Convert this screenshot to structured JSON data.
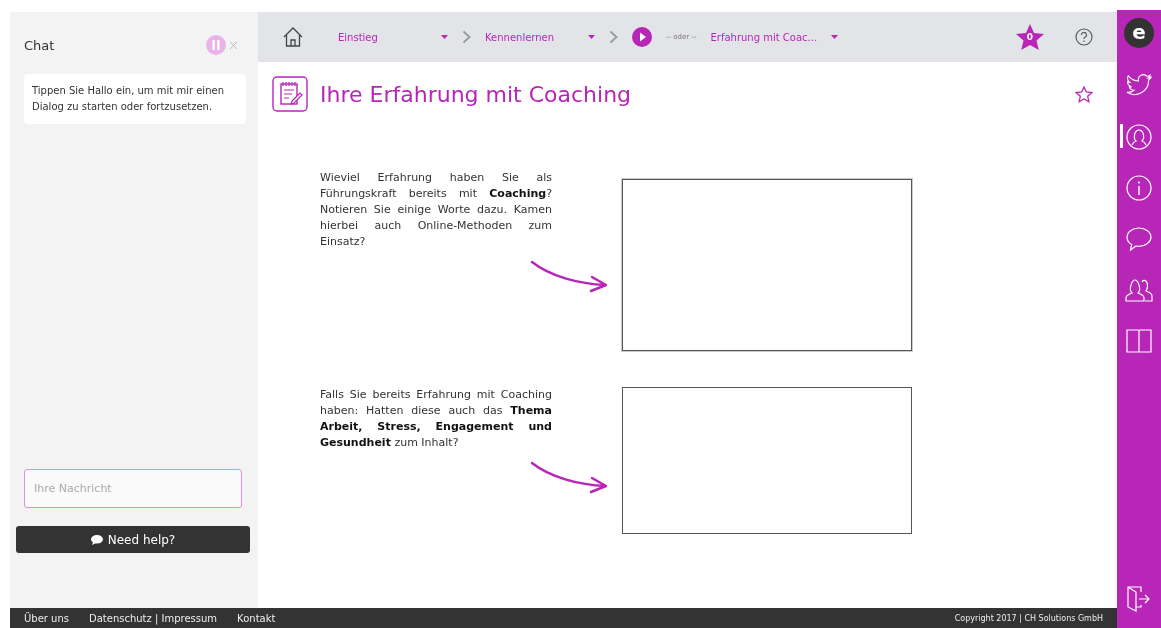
{
  "chat": {
    "title": "Chat",
    "paused": true,
    "hint": "Tippen Sie Hallo ein, um mit mir einen Dialog zu starten oder fortzusetzen.",
    "input": {
      "placeholder": "Ihre Nachricht"
    },
    "help_button": "Need help?"
  },
  "breadcrumbs": [
    {
      "kind": "link",
      "label": "Einstieg"
    },
    {
      "kind": "link",
      "label": "Kennenlernen"
    },
    {
      "kind": "current",
      "label": "Erfahrung mit Coac...",
      "prefix": "-- oder --"
    }
  ],
  "favorites_count": "0",
  "page": {
    "title": "Ihre Erfahrung mit Coaching",
    "bookmarked": false
  },
  "questions": [
    {
      "text": "Wieviel Erfahrung haben Sie als Führungskraft bereits mit **Coaching**? Notieren Sie einige Worte dazu. Kamen hierbei auch Online-Methoden zum Einsatz?",
      "focused": true
    },
    {
      "text": "Falls Sie bereits Erfahrung mit Coaching haben: Hatten diese auch das **Thema Arbeit, Stress, Engagement und Gesundheit** zum Inhalt?",
      "focused": false
    }
  ],
  "sidebar": {
    "logo": "e",
    "items": [
      {
        "kind": "bird",
        "selected": false
      },
      {
        "kind": "person",
        "selected": true
      },
      {
        "kind": "info",
        "selected": false
      },
      {
        "kind": "speech",
        "selected": false
      },
      {
        "kind": "people",
        "selected": false
      },
      {
        "kind": "book",
        "selected": false
      }
    ]
  },
  "footer": {
    "links": [
      "Über uns",
      "Datenschutz | Impressum",
      "Kontakt"
    ],
    "copyright": "Copyright 2017 | CH Solutions GmbH"
  }
}
